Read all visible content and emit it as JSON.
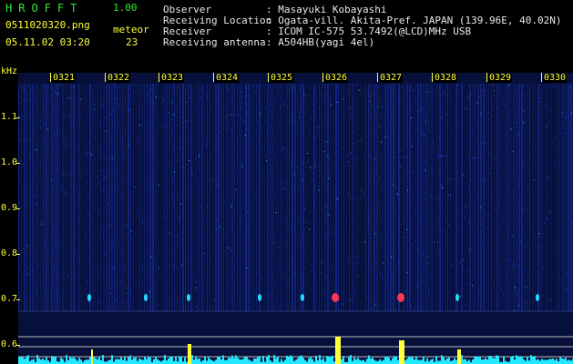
{
  "header": {
    "app_name": "HROFFT",
    "version": "1.00",
    "filename": "0511020320.png",
    "datetime": "05.11.02 03:20",
    "meteor_label": "meteor",
    "meteor_count": "23",
    "info_labels": [
      "Observer",
      "Receiving Location",
      "Receiver",
      "Receiving antenna"
    ],
    "info_values": [
      ": Masayuki Kobayashi",
      ": Ogata-vill. Akita-Pref. JAPAN (139.96E, 40.02N)",
      ": ICOM IC-575 53.7492(@LCD)MHz USB",
      ": A504HB(yagi 4el)"
    ]
  },
  "spectrogram": {
    "unit_label": "kHz",
    "freq_labels": [
      "1.1",
      "1.0",
      "0.9",
      "0.8",
      "0.7",
      "0.6"
    ],
    "time_labels": [
      "0321",
      "0322",
      "0323",
      "0324",
      "0325",
      "0326",
      "0327",
      "0328",
      "0329",
      "0330"
    ],
    "colors": {
      "background": "#06103a",
      "noise": "#2a4cff",
      "signal": "#22ddff",
      "meteor": "#ff3355",
      "profile": "#22e8ff",
      "peak": "#ffff3a"
    }
  }
}
